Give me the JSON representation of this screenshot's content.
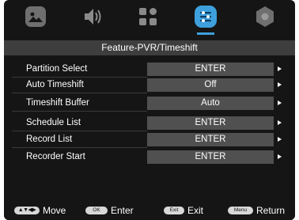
{
  "icon_bar": {
    "items": [
      {
        "icon": "picture-icon",
        "active": false
      },
      {
        "icon": "sound-icon",
        "active": false
      },
      {
        "icon": "channel-grid-icon",
        "active": false
      },
      {
        "icon": "feature-icon",
        "active": true
      },
      {
        "icon": "lock-icon",
        "active": false
      }
    ],
    "accent": "#3ea0dc"
  },
  "title": "Feature-PVR/Timeshift",
  "menu": [
    {
      "label": "Partition Select",
      "value": "ENTER"
    },
    {
      "label": "Auto Timeshift",
      "value": "Off"
    },
    {
      "label": "Timeshift Buffer",
      "value": "Auto"
    },
    {
      "label": "Schedule List",
      "value": "ENTER"
    },
    {
      "label": "Record List",
      "value": "ENTER"
    },
    {
      "label": "Recorder Start",
      "value": "ENTER"
    }
  ],
  "footer": {
    "move_key": "▲▼◀▶",
    "move_label": "Move",
    "ok_key": "OK",
    "ok_label": "Enter",
    "exit_key": "Exit",
    "exit_label": "Exit",
    "menu_key": "Menu",
    "menu_label": "Return"
  }
}
